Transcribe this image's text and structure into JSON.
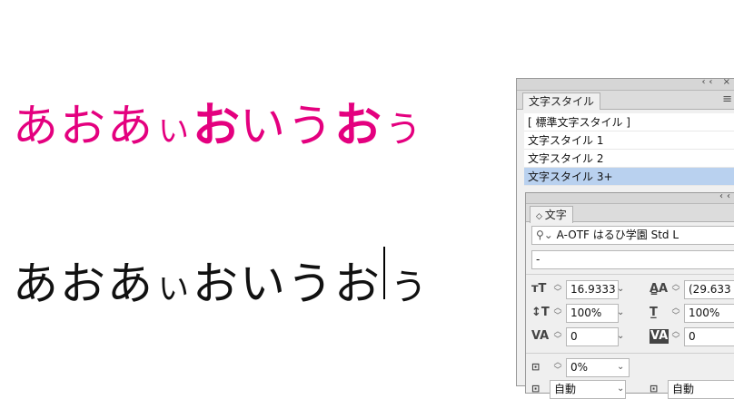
{
  "samples": {
    "pink": {
      "c1": "あおあ",
      "c2": "い",
      "c3": "お",
      "c4": "いう",
      "c5": "お",
      "c6": "う",
      "color": "#e4007f"
    },
    "black": {
      "c1": "あおあ",
      "c2": "い",
      "c3": "お",
      "c4": "いう",
      "c5": "お",
      "c6": "う",
      "color": "#111111"
    }
  },
  "styles_panel": {
    "tab": "文字スタイル",
    "items": [
      "[ 標準文字スタイル ]",
      "文字スタイル 1",
      "文字スタイル 2",
      "文字スタイル 3+"
    ],
    "selected_index": 3,
    "selected_color": "#b9d1ef"
  },
  "char_panel": {
    "tab": "文字",
    "font_family": "A-OTF はるひ学園 Std L",
    "font_style": "-",
    "font_size": "16.9333",
    "leading": "(29.633",
    "vertical_scale": "100%",
    "horizontal_scale": "100%",
    "kerning": "0",
    "tracking": "0",
    "tsume": "0%",
    "aki_before": "自動",
    "aki_after": "自動"
  }
}
